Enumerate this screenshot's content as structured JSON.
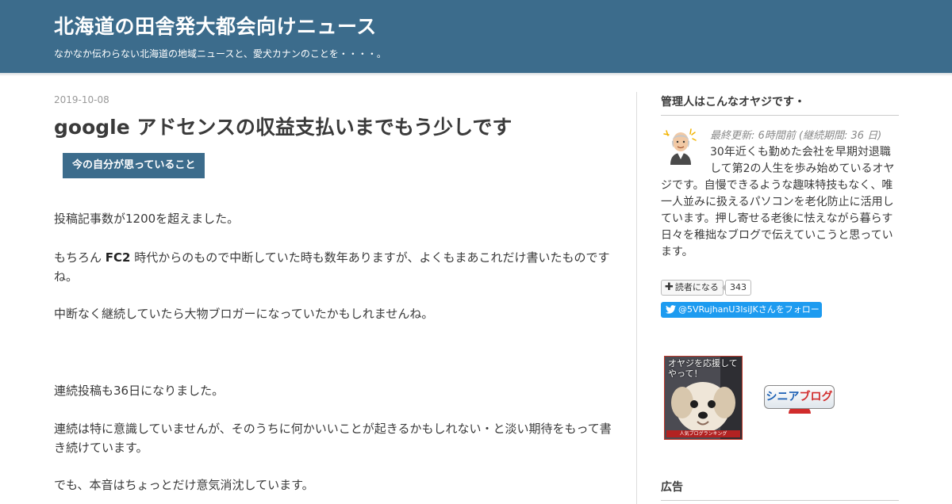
{
  "header": {
    "title": "北海道の田舎発大都会向けニュース",
    "description": "なかなか伝わらない北海道の地域ニュースと、愛犬カナンのことを・・・・。"
  },
  "entry": {
    "date": "2019-10-08",
    "title": "google アドセンスの収益支払いまでもう少しです",
    "category": "今の自分が思っていること",
    "p1": "投稿記事数が1200を超えました。",
    "p2_prefix": "もちろん ",
    "p2_bold": "FC2",
    "p2_suffix": " 時代からのもので中断していた時も数年ありますが、よくもまあこれだけ書いたものですね。",
    "p3": "中断なく継続していたら大物ブロガーになっていたかもしれませんね。",
    "p4": "連続投稿も36日になりました。",
    "p5": "連続は特に意識していませんが、そのうちに何かいいことが起きるかもしれない・と淡い期待をもって書き続けています。",
    "p6": "でも、本音はちょっとだけ意気消沈しています。"
  },
  "sidebar": {
    "profile_heading": "管理人はこんなオヤジです・",
    "last_update": "最終更新: 6時間前 (継続期間: 36 日)",
    "profile_text": "30年近くも勤めた会社を早期対退職して第2の人生を歩み始めているオヤジです。自慢できるような趣味特技もなく、唯一人並みに扱えるパソコンを老化防止に活用しています。押し寄せる老後に怯えながら暮らす日々を稚拙なブログで伝えていこうと思っています。",
    "subscribe_label": "読者になる",
    "reader_count": "343",
    "twitter_label": "@5VRujhanU3lsiJKさんをフォロー",
    "banner_dog_caption": "オヤジを応援してやって！",
    "banner_dog_rank": "人気ブログランキング",
    "banner_senior_a": "シニア",
    "banner_senior_b": "ブログ",
    "ad_heading": "広告"
  }
}
